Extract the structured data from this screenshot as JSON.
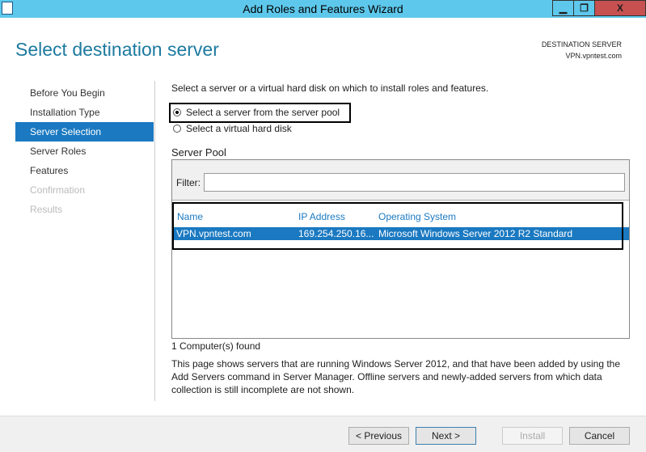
{
  "window": {
    "title": "Add Roles and Features Wizard",
    "minimize": "▁",
    "restore": "❐",
    "close": "X"
  },
  "header": {
    "title": "Select destination server",
    "dest_label": "DESTINATION SERVER",
    "dest_value": "VPN.vpntest.com"
  },
  "nav": [
    {
      "label": "Before You Begin"
    },
    {
      "label": "Installation Type"
    },
    {
      "label": "Server Selection"
    },
    {
      "label": "Server Roles"
    },
    {
      "label": "Features"
    },
    {
      "label": "Confirmation"
    },
    {
      "label": "Results"
    }
  ],
  "main": {
    "intro": "Select a server or a virtual hard disk on which to install roles and features.",
    "option_pool": "Select a server from the server pool",
    "option_vhd": "Select a virtual hard disk",
    "pool_title": "Server Pool",
    "filter_label": "Filter:",
    "filter_value": "",
    "columns": [
      "Name",
      "IP Address",
      "Operating System"
    ],
    "rows": [
      {
        "name": "VPN.vpntest.com",
        "ip": "169.254.250.16...",
        "os": "Microsoft Windows Server 2012 R2 Standard"
      }
    ],
    "count": "1 Computer(s) found",
    "note": "This page shows servers that are running Windows Server 2012, and that have been added by using the Add Servers command in Server Manager. Offline servers and newly-added servers from which data collection is still incomplete are not shown."
  },
  "footer": {
    "previous": "< Previous",
    "next": "Next >",
    "install": "Install",
    "cancel": "Cancel"
  }
}
